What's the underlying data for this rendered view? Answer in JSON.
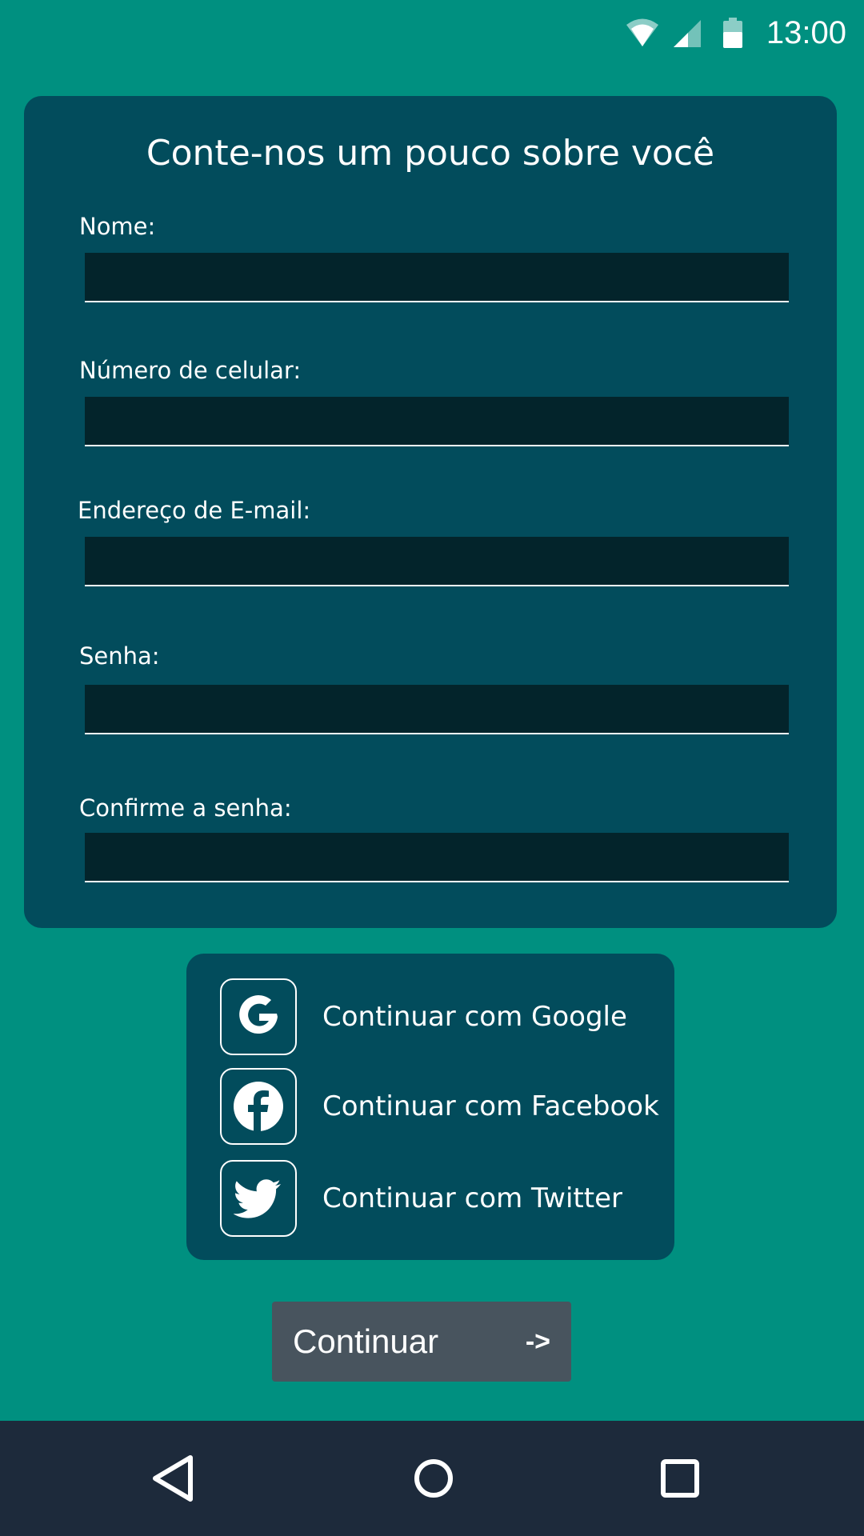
{
  "status_bar": {
    "time": "13:00",
    "icons": [
      "wifi-icon",
      "cell-signal-icon",
      "battery-icon"
    ]
  },
  "form": {
    "title": "Conte-nos um pouco sobre você",
    "fields": [
      {
        "label": "Nome:",
        "value": "",
        "placeholder": ""
      },
      {
        "label": "Número de celular:",
        "value": "",
        "placeholder": ""
      },
      {
        "label": "Endereço de E-mail:",
        "value": "",
        "placeholder": ""
      },
      {
        "label": "Senha:",
        "value": "",
        "placeholder": ""
      },
      {
        "label": "Confirme a senha:",
        "value": "",
        "placeholder": ""
      }
    ]
  },
  "social": {
    "google": {
      "label": "Continuar com Google",
      "icon": "google-icon"
    },
    "facebook": {
      "label": "Continuar com Facebook",
      "icon": "facebook-icon"
    },
    "twitter": {
      "label": "Continuar com Twitter",
      "icon": "twitter-icon"
    }
  },
  "continue_button": {
    "label": "Continuar",
    "arrow": "->"
  },
  "nav_bar": {
    "icons": [
      "back-icon",
      "home-icon",
      "recents-icon"
    ]
  },
  "colors": {
    "background": "#009080",
    "card": "#024c5c",
    "input": "#03242b",
    "button": "#48545e",
    "nav_bar": "#1d2a3b",
    "text": "#ffffff"
  }
}
